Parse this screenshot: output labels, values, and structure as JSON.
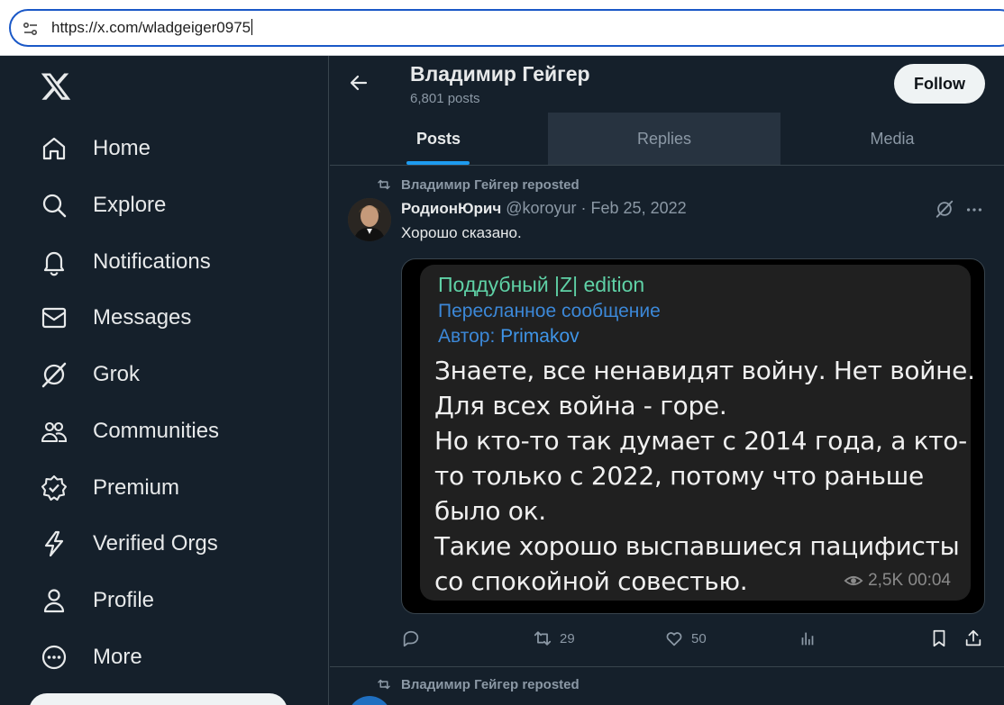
{
  "browser": {
    "url": "https://x.com/wladgeiger0975"
  },
  "sidebar": {
    "items": [
      {
        "label": "Home",
        "icon": "home-icon"
      },
      {
        "label": "Explore",
        "icon": "search-icon"
      },
      {
        "label": "Notifications",
        "icon": "bell-icon"
      },
      {
        "label": "Messages",
        "icon": "envelope-icon"
      },
      {
        "label": "Grok",
        "icon": "grok-icon"
      },
      {
        "label": "Communities",
        "icon": "people-icon"
      },
      {
        "label": "Premium",
        "icon": "verified-badge-icon"
      },
      {
        "label": "Verified Orgs",
        "icon": "lightning-icon"
      },
      {
        "label": "Profile",
        "icon": "person-icon"
      },
      {
        "label": "More",
        "icon": "more-circle-icon"
      }
    ]
  },
  "profile": {
    "name": "Владимир Гейгер",
    "posts_count": "6,801 posts",
    "follow_label": "Follow"
  },
  "tabs": [
    {
      "label": "Posts",
      "active": true
    },
    {
      "label": "Replies",
      "active": false
    },
    {
      "label": "Media",
      "active": false
    }
  ],
  "tweet": {
    "repost_label": "Владимир Гейгер reposted",
    "author": "РодионЮрич",
    "handle_date": "@koroyur · Feb 25, 2022",
    "text": "Хорошо сказано.",
    "media": {
      "from": "Поддубный |Z| edition",
      "forwarded": "Пересланное сообщение",
      "author_prefix": "Автор: ",
      "author_name": "Primakov",
      "lines": [
        "Знаете, все ненавидят войну. Нет войне.",
        "Для всех война - горе.",
        "Но кто-то так думает с 2014 года, а кто-",
        "то только с 2022, потому что раньше",
        "было ок.",
        "Такие хорошо выспавшиеся пацифисты",
        "со спокойной совестью."
      ],
      "meta": "2,5K 00:04"
    },
    "reposts": "29",
    "likes": "50"
  },
  "second_tweet": {
    "repost_label": "Владимир Гейгер reposted"
  },
  "colors": {
    "background": "#15202b",
    "accent": "#1d9bf0",
    "muted": "#8b98a5"
  }
}
